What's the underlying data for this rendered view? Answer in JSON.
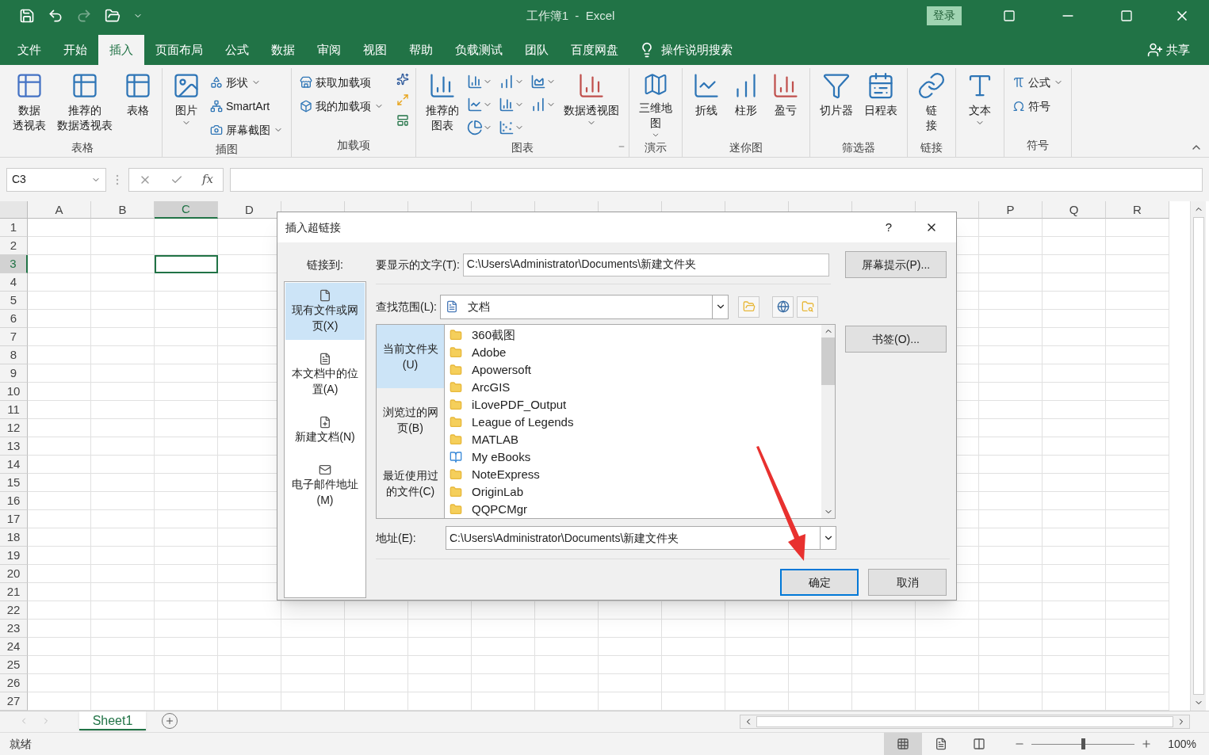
{
  "title_bar": {
    "title": "工作簿1  -  Excel",
    "login": "登录"
  },
  "ribbon_tabs": [
    {
      "label": "文件",
      "selected": false
    },
    {
      "label": "开始",
      "selected": false
    },
    {
      "label": "插入",
      "selected": true
    },
    {
      "label": "页面布局",
      "selected": false
    },
    {
      "label": "公式",
      "selected": false
    },
    {
      "label": "数据",
      "selected": false
    },
    {
      "label": "审阅",
      "selected": false
    },
    {
      "label": "视图",
      "selected": false
    },
    {
      "label": "帮助",
      "selected": false
    },
    {
      "label": "负载测试",
      "selected": false
    },
    {
      "label": "团队",
      "selected": false
    },
    {
      "label": "百度网盘",
      "selected": false
    }
  ],
  "tell_me": "操作说明搜索",
  "share": "共享",
  "ribbon_groups": [
    {
      "label": "表格",
      "items": [
        {
          "kind": "large",
          "lines": [
            "数据",
            "透视表"
          ],
          "dropdown": false
        },
        {
          "kind": "large",
          "lines": [
            "推荐的",
            "数据透视表"
          ],
          "dropdown": false
        },
        {
          "kind": "large",
          "lines": [
            "表格"
          ],
          "dropdown": false
        }
      ]
    },
    {
      "label": "插图",
      "items": [
        {
          "kind": "large",
          "lines": [
            "图片"
          ],
          "dropdown": true
        },
        {
          "kind": "small",
          "label": "形状",
          "dropdown": true
        },
        {
          "kind": "small",
          "label": "SmartArt",
          "dropdown": false
        },
        {
          "kind": "small",
          "label": "屏幕截图",
          "dropdown": true
        }
      ]
    },
    {
      "label": "加载项",
      "items": [
        {
          "kind": "small",
          "label": "获取加载项",
          "dropdown": false
        },
        {
          "kind": "small",
          "label": "我的加载项",
          "dropdown": true
        },
        {
          "kind": "icons"
        }
      ]
    },
    {
      "label": "图表",
      "items": [
        {
          "kind": "large",
          "lines": [
            "推荐的",
            "图表"
          ],
          "dropdown": false
        },
        {
          "kind": "chart-grid"
        },
        {
          "kind": "large",
          "lines": [
            "数据透视图"
          ],
          "dropdown": true
        }
      ],
      "launcher": true
    },
    {
      "label": "演示",
      "items": [
        {
          "kind": "large",
          "lines": [
            "三维地",
            "图"
          ],
          "dropdown": true
        }
      ]
    },
    {
      "label": "迷你图",
      "items": [
        {
          "kind": "large",
          "lines": [
            "折线"
          ],
          "dropdown": false
        },
        {
          "kind": "large",
          "lines": [
            "柱形"
          ],
          "dropdown": false
        },
        {
          "kind": "large",
          "lines": [
            "盈亏"
          ],
          "dropdown": false
        }
      ]
    },
    {
      "label": "筛选器",
      "items": [
        {
          "kind": "large",
          "lines": [
            "切片器"
          ],
          "dropdown": false
        },
        {
          "kind": "large",
          "lines": [
            "日程表"
          ],
          "dropdown": false
        }
      ]
    },
    {
      "label": "链接",
      "items": [
        {
          "kind": "large",
          "lines": [
            "链",
            "接"
          ],
          "dropdown": false
        }
      ]
    },
    {
      "items": [
        {
          "kind": "large",
          "lines": [
            "文本"
          ],
          "dropdown": true
        }
      ]
    },
    {
      "label": "符号",
      "items": [
        {
          "kind": "small",
          "label": "公式",
          "dropdown": true
        },
        {
          "kind": "small",
          "label": "符号",
          "dropdown": false
        }
      ]
    }
  ],
  "formula_bar": {
    "name_box": "C3",
    "fx": "fx"
  },
  "grid": {
    "columns": [
      {
        "label": "A",
        "selected": false
      },
      {
        "label": "B",
        "selected": false
      },
      {
        "label": "C",
        "selected": true
      },
      {
        "label": "D",
        "selected": false
      },
      {
        "selected": false
      },
      {
        "selected": false
      },
      {
        "selected": false
      },
      {
        "selected": false
      },
      {
        "selected": false
      },
      {
        "selected": false
      },
      {
        "selected": false
      },
      {
        "selected": false
      },
      {
        "selected": false
      },
      {
        "selected": false
      },
      {
        "selected": false
      },
      {
        "label": "P",
        "selected": false
      },
      {
        "label": "Q",
        "selected": false
      },
      {
        "label": "R",
        "selected": false
      }
    ],
    "rows": [
      {
        "label": "1",
        "selected": false
      },
      {
        "label": "2",
        "selected": false
      },
      {
        "label": "3",
        "selected": true
      },
      {
        "label": "4",
        "selected": false
      },
      {
        "label": "5",
        "selected": false
      },
      {
        "label": "6",
        "selected": false
      },
      {
        "label": "7",
        "selected": false
      },
      {
        "label": "8",
        "selected": false
      },
      {
        "label": "9",
        "selected": false
      },
      {
        "label": "10",
        "selected": false
      },
      {
        "label": "11",
        "selected": false
      },
      {
        "label": "12",
        "selected": false
      },
      {
        "label": "13",
        "selected": false
      },
      {
        "label": "14",
        "selected": false
      },
      {
        "label": "15",
        "selected": false
      },
      {
        "label": "16",
        "selected": false
      },
      {
        "label": "17",
        "selected": false
      },
      {
        "label": "18",
        "selected": false
      },
      {
        "label": "19",
        "selected": false
      },
      {
        "label": "20",
        "selected": false
      },
      {
        "label": "21",
        "selected": false
      },
      {
        "label": "22",
        "selected": false
      },
      {
        "label": "23",
        "selected": false
      },
      {
        "label": "24",
        "selected": false
      },
      {
        "label": "25",
        "selected": false
      },
      {
        "label": "26",
        "selected": false
      },
      {
        "label": "27",
        "selected": false
      }
    ]
  },
  "sheets": [
    {
      "label": "Sheet1",
      "selected": true
    }
  ],
  "status_bar": {
    "status": "就绪",
    "views": [
      {
        "kind": "normal",
        "selected": true
      },
      {
        "kind": "page-layout",
        "selected": false
      },
      {
        "kind": "page-break",
        "selected": false
      }
    ],
    "zoom": {
      "level": 0.5,
      "reading": "100%"
    }
  },
  "dialog": {
    "title": "插入超链接",
    "help": "?",
    "link_to_label": "链接到:",
    "link_to": [
      {
        "lines": [
          "现有文件或网",
          "页(X)"
        ],
        "selected": true
      },
      {
        "lines": [
          "本文档中的位",
          "置(A)"
        ],
        "selected": false
      },
      {
        "lines": [
          "新建文档(N)"
        ],
        "selected": false
      },
      {
        "lines": [
          "电子邮件地址",
          "(M)"
        ],
        "selected": false
      }
    ],
    "display_text": {
      "label": "要显示的文字(T):",
      "value": "C:\\Users\\Administrator\\Documents\\新建文件夹"
    },
    "screen_tip_button": "屏幕提示(P)...",
    "look_in": {
      "label": "查找范围(L):",
      "value": "文档"
    },
    "nav": [
      {
        "lines": [
          "当前文件夹",
          "(U)"
        ],
        "selected": true
      },
      {
        "lines": [
          "浏览过的网",
          "页(B)"
        ],
        "selected": false
      },
      {
        "lines": [
          "最近使用过",
          "的文件(C)"
        ],
        "selected": false
      }
    ],
    "files": [
      {
        "name": "360截图",
        "kind": "folder"
      },
      {
        "name": "Adobe",
        "kind": "folder"
      },
      {
        "name": "Apowersoft",
        "kind": "folder"
      },
      {
        "name": "ArcGIS",
        "kind": "folder"
      },
      {
        "name": "iLovePDF_Output",
        "kind": "folder"
      },
      {
        "name": "League of Legends",
        "kind": "folder"
      },
      {
        "name": "MATLAB",
        "kind": "folder"
      },
      {
        "name": "My eBooks",
        "kind": "special"
      },
      {
        "name": "NoteExpress",
        "kind": "folder"
      },
      {
        "name": "OriginLab",
        "kind": "folder"
      },
      {
        "name": "QQPCMgr",
        "kind": "folder"
      }
    ],
    "bookmark_button": "书签(O)...",
    "address": {
      "label": "地址(E):",
      "value": "C:\\Users\\Administrator\\Documents\\新建文件夹"
    },
    "buttons": [
      {
        "label": "确定",
        "default": true
      },
      {
        "label": "取消",
        "default": false
      }
    ]
  }
}
